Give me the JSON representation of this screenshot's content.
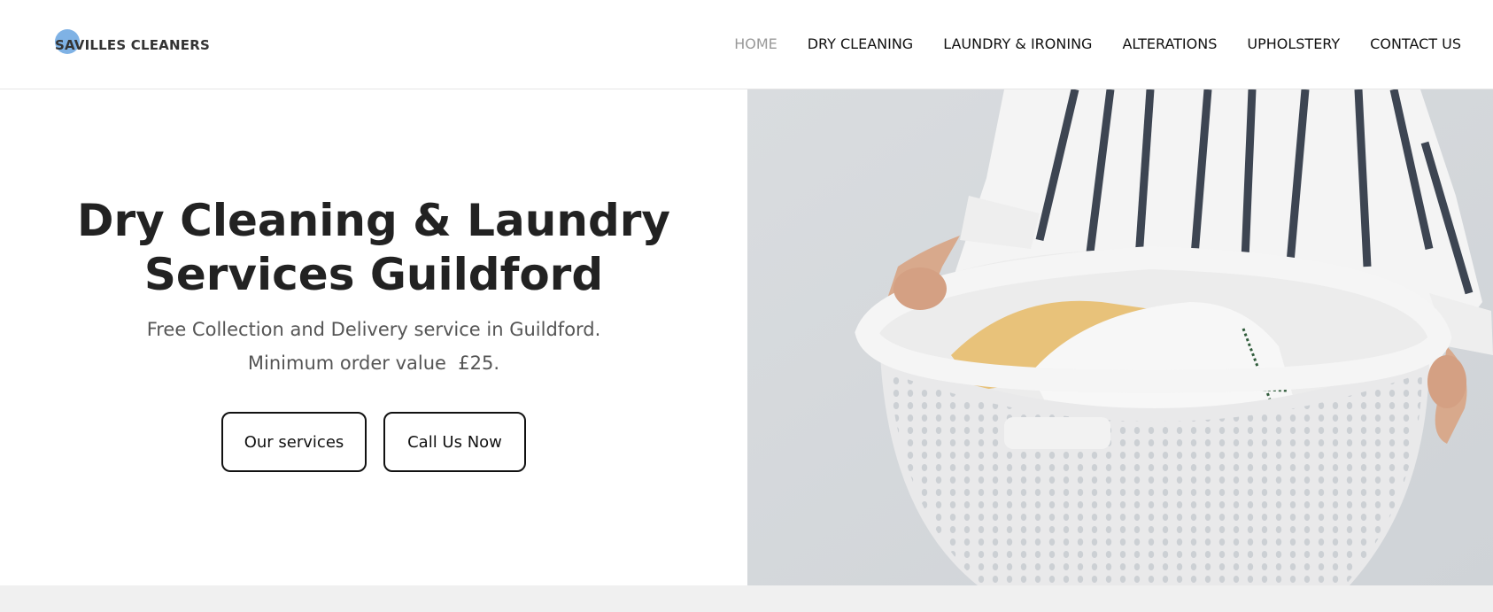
{
  "header": {
    "logo_text": "SAVILLES CLEANERS",
    "nav": [
      {
        "label": "HOME",
        "active": true
      },
      {
        "label": "DRY CLEANING",
        "active": false
      },
      {
        "label": "LAUNDRY & IRONING",
        "active": false
      },
      {
        "label": "ALTERATIONS",
        "active": false
      },
      {
        "label": "UPHOLSTERY",
        "active": false
      },
      {
        "label": "CONTACT US",
        "active": false
      }
    ]
  },
  "hero": {
    "title_line1": "Dry Cleaning & Laundry",
    "title_line2": "Services Guildford",
    "sub_line1": "Free Collection and Delivery service in Guildford.",
    "sub_line2": "Minimum order value  £25.",
    "button_services": "Our services",
    "button_call": "Call Us Now",
    "image_icon": "laundry-basket-photo"
  },
  "colors": {
    "logo_accent": "#7fb2e5",
    "nav_active": "#999999",
    "text_dark": "#222222",
    "text_muted": "#555555"
  }
}
